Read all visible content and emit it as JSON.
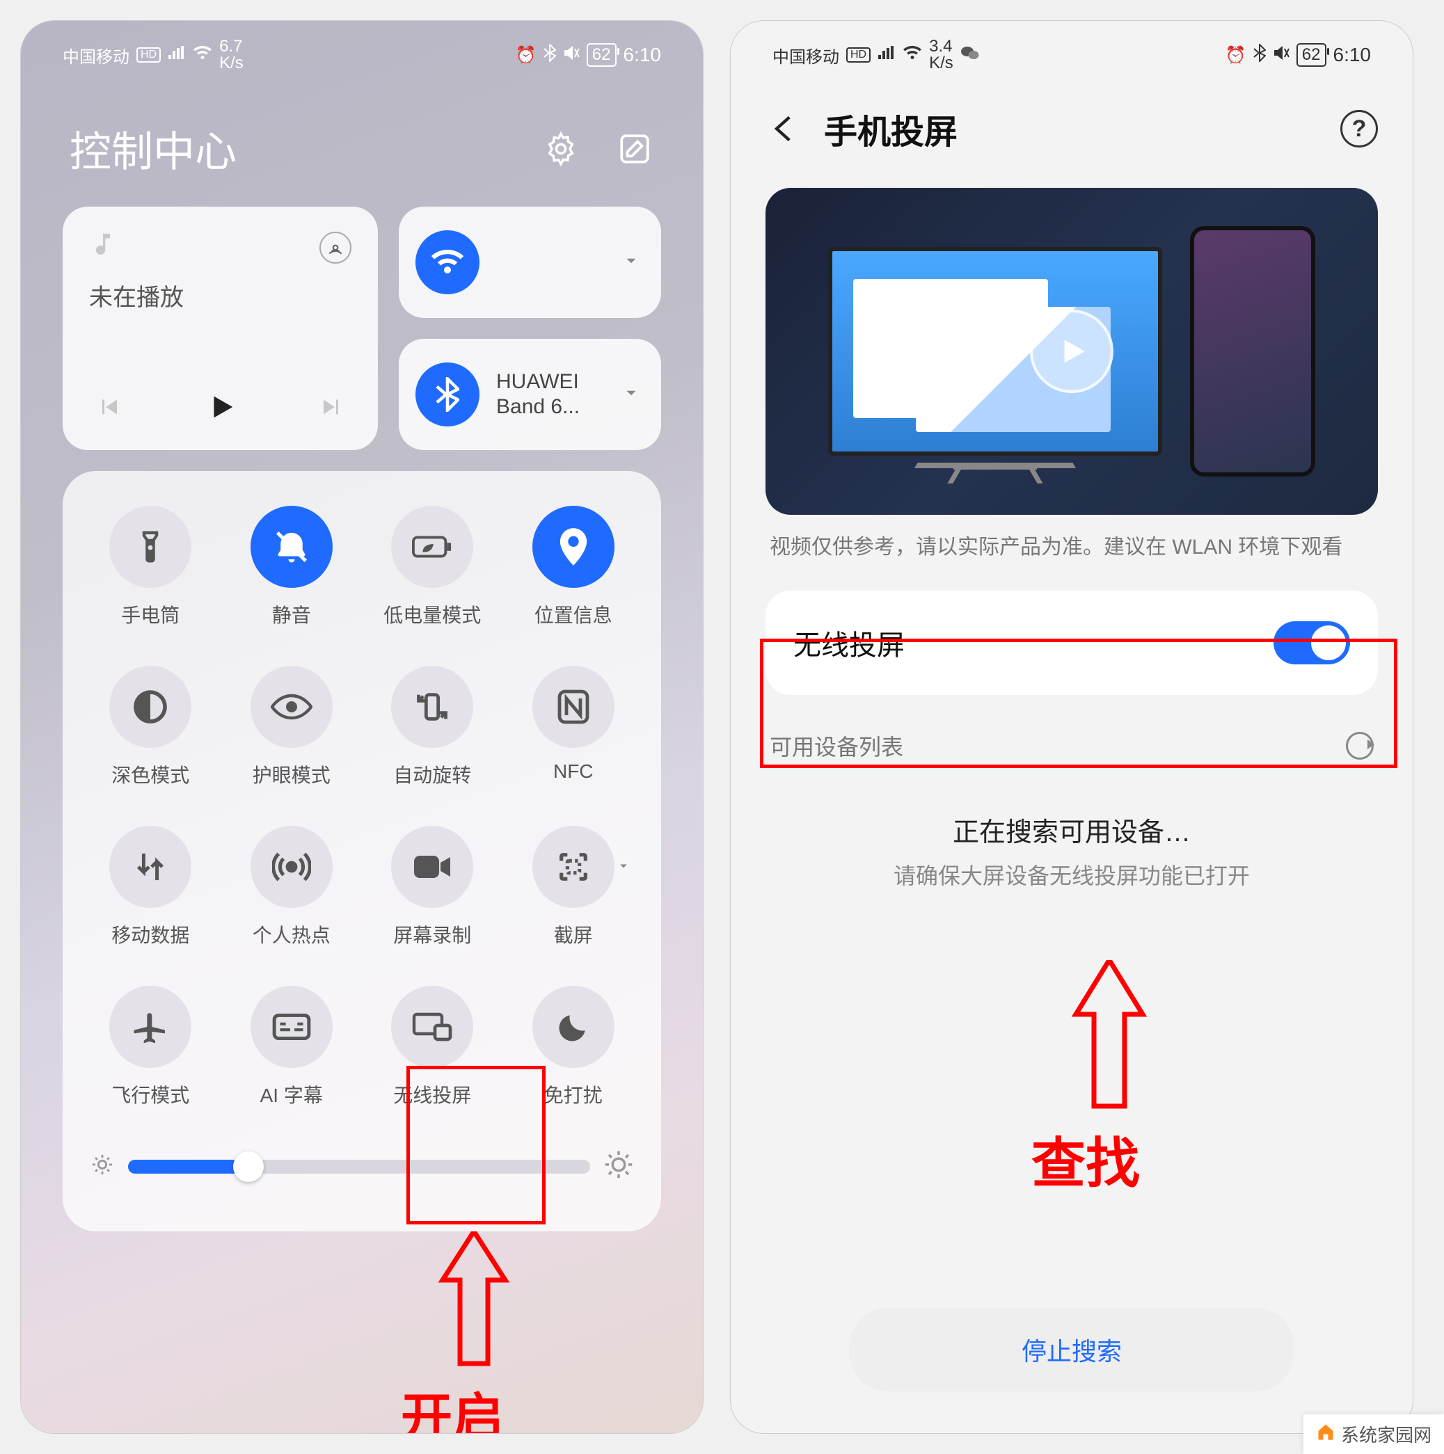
{
  "status": {
    "carrier": "中国移动",
    "net_left": "6.7",
    "net_right": "3.4",
    "net_unit": "K/s",
    "battery": "62",
    "time": "6:10"
  },
  "left": {
    "header": {
      "title": "控制中心"
    },
    "media": {
      "status": "未在播放"
    },
    "conn": {
      "wifi_label": "",
      "bt_label": "HUAWEI Band 6..."
    },
    "tiles": [
      {
        "key": "flashlight",
        "label": "手电筒",
        "icon": "flashlight",
        "active": false,
        "caret": false
      },
      {
        "key": "mute",
        "label": "静音",
        "icon": "mute",
        "active": true,
        "caret": false
      },
      {
        "key": "lowpower",
        "label": "低电量模式",
        "icon": "battery-leaf",
        "active": false,
        "caret": false
      },
      {
        "key": "location",
        "label": "位置信息",
        "icon": "location",
        "active": true,
        "caret": false
      },
      {
        "key": "darkmode",
        "label": "深色模式",
        "icon": "darkmode",
        "active": false,
        "caret": false
      },
      {
        "key": "eyecare",
        "label": "护眼模式",
        "icon": "eye",
        "active": false,
        "caret": false
      },
      {
        "key": "autorotate",
        "label": "自动旋转",
        "icon": "rotate",
        "active": false,
        "caret": false
      },
      {
        "key": "nfc",
        "label": "NFC",
        "icon": "nfc",
        "active": false,
        "caret": false
      },
      {
        "key": "mobiledata",
        "label": "移动数据",
        "icon": "data",
        "active": false,
        "caret": false
      },
      {
        "key": "hotspot",
        "label": "个人热点",
        "icon": "hotspot",
        "active": false,
        "caret": false
      },
      {
        "key": "screenrec",
        "label": "屏幕录制",
        "icon": "record",
        "active": false,
        "caret": false
      },
      {
        "key": "screenshot",
        "label": "截屏",
        "icon": "screenshot",
        "active": false,
        "caret": true
      },
      {
        "key": "airplane",
        "label": "飞行模式",
        "icon": "airplane",
        "active": false,
        "caret": false
      },
      {
        "key": "aicaption",
        "label": "AI 字幕",
        "icon": "caption",
        "active": false,
        "caret": false
      },
      {
        "key": "wirelesscast",
        "label": "无线投屏",
        "icon": "cast",
        "active": false,
        "caret": false
      },
      {
        "key": "dnd",
        "label": "免打扰",
        "icon": "moon",
        "active": false,
        "caret": false
      }
    ],
    "annotation": "开启"
  },
  "right": {
    "header": {
      "title": "手机投屏"
    },
    "video_note": "视频仅供参考，请以实际产品为准。建议在 WLAN 环境下观看",
    "toggle": {
      "label": "无线投屏",
      "on": true
    },
    "device_list_header": "可用设备列表",
    "searching_title": "正在搜索可用设备…",
    "searching_sub": "请确保大屏设备无线投屏功能已打开",
    "stop_button": "停止搜索",
    "annotation": "查找"
  },
  "watermark": "系统家园网",
  "colors": {
    "accent": "#1f6bff",
    "annotation": "#ff0000"
  }
}
